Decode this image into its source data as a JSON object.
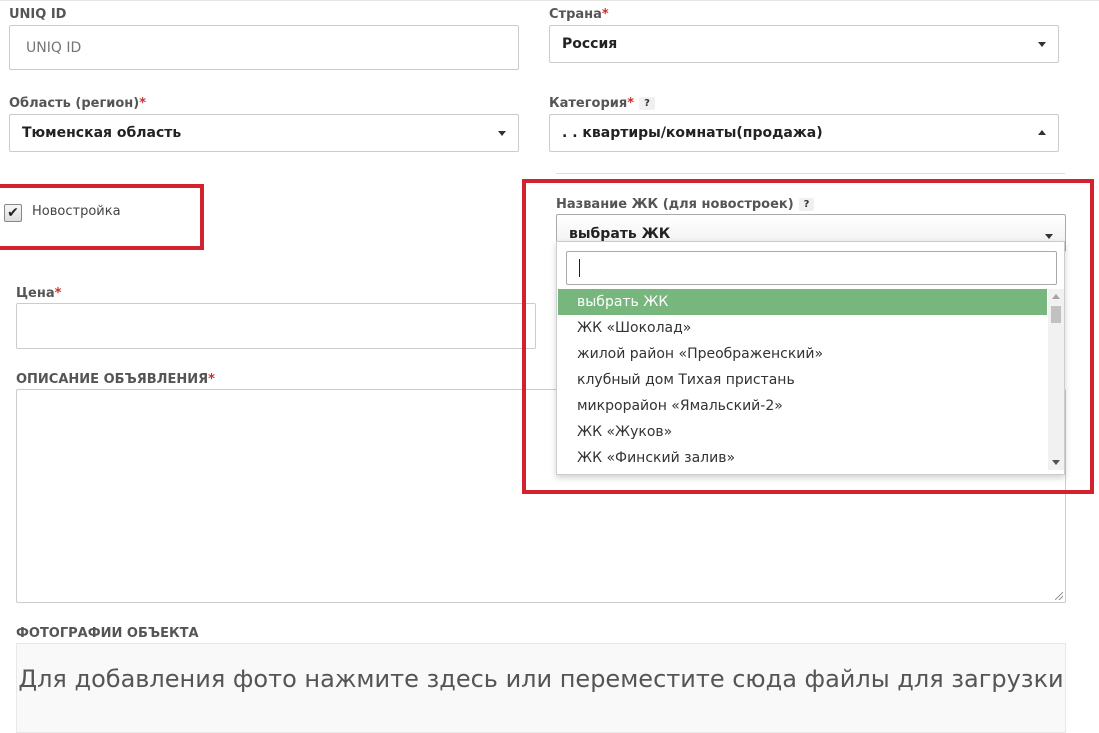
{
  "form": {
    "uniq_id": {
      "label": "UNIQ ID",
      "placeholder": "UNIQ ID",
      "value": ""
    },
    "country": {
      "label": "Страна",
      "required": "*",
      "value": "Россия"
    },
    "region": {
      "label": "Область (регион)",
      "required": "*",
      "value": "Тюменская область"
    },
    "category": {
      "label": "Категория",
      "required": "*",
      "help": "?",
      "value": ". . квартиры/комнаты(продажа)"
    },
    "new_building": {
      "label": "Новостройка",
      "checked": true,
      "check_glyph": "✔"
    },
    "complex": {
      "label": "Название ЖК (для новостроек)",
      "help": "?",
      "value": "выбрать ЖК",
      "search_value": "",
      "options": [
        "выбрать ЖК",
        "ЖК «Шоколад»",
        "жилой район «Преображенский»",
        "клубный дом Тихая пристань",
        "микрорайон «Ямальский-2»",
        "ЖК «Жуков»",
        "ЖК «Финский залив»"
      ],
      "selected_index": 0
    },
    "price": {
      "label": "Цена",
      "required": "*",
      "value": ""
    },
    "description": {
      "label": "ОПИСАНИЕ ОБЪЯВЛЕНИЯ",
      "required": "*",
      "value": ""
    },
    "photos": {
      "label": "ФОТОГРАФИИ ОБЪЕКТА",
      "dropzone_text": "Для добавления фото нажмите здесь или переместите сюда файлы для загрузки"
    }
  },
  "colors": {
    "highlight_box": "#d0232f",
    "selected_option": "#77b77d",
    "required_mark": "#c9302c"
  },
  "icons": {
    "select_caret": "chevron-down-icon",
    "checkbox_mark": "checkmark-icon"
  }
}
